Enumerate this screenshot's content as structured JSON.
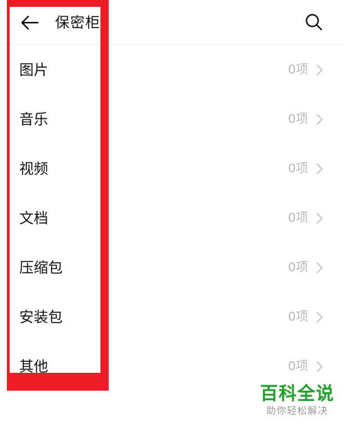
{
  "header": {
    "title": "保密柜"
  },
  "icons": {
    "back": "arrow-left-icon",
    "search": "search-icon",
    "chevron": "chevron-right-icon"
  },
  "colors": {
    "annotation": "#ee1c25",
    "watermark_green": "#20a028",
    "muted_text": "#b8b8b8"
  },
  "items": [
    {
      "label": "图片",
      "count": "0项"
    },
    {
      "label": "音乐",
      "count": "0项"
    },
    {
      "label": "视频",
      "count": "0项"
    },
    {
      "label": "文档",
      "count": "0项"
    },
    {
      "label": "压缩包",
      "count": "0项"
    },
    {
      "label": "安装包",
      "count": "0项"
    },
    {
      "label": "其他",
      "count": "0项"
    }
  ],
  "watermark": {
    "main": "百科全说",
    "sub": "助你轻松解决"
  }
}
